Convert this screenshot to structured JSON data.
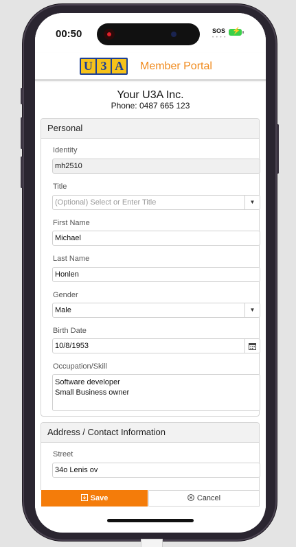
{
  "status_bar": {
    "time": "00:50",
    "sos": "SOS",
    "signal_dots": "• • • •"
  },
  "header": {
    "logo_letters": [
      "U",
      "3",
      "A"
    ],
    "portal_title": "Member Portal"
  },
  "org": {
    "name": "Your U3A Inc.",
    "phone": "Phone: 0487 665 123"
  },
  "personal": {
    "heading": "Personal",
    "identity": {
      "label": "Identity",
      "value": "mh2510"
    },
    "title": {
      "label": "Title",
      "placeholder": "(Optional) Select or Enter Title"
    },
    "first_name": {
      "label": "First Name",
      "value": "Michael"
    },
    "last_name": {
      "label": "Last Name",
      "value": "Honlen"
    },
    "gender": {
      "label": "Gender",
      "value": "Male"
    },
    "birth_date": {
      "label": "Birth Date",
      "value": "10/8/1953"
    },
    "occupation": {
      "label": "Occupation/Skill",
      "value": "Software developer\nSmall Business owner"
    }
  },
  "address": {
    "heading": "Address / Contact Information",
    "street": {
      "label": "Street",
      "value": "34o Lenis ov"
    }
  },
  "actions": {
    "save_label": "Save",
    "cancel_label": "Cancel"
  },
  "colors": {
    "accent": "#f47c0a",
    "portal_title": "#f08a1c",
    "logo_blue": "#1c3f94",
    "logo_yellow": "#f6c21a"
  }
}
